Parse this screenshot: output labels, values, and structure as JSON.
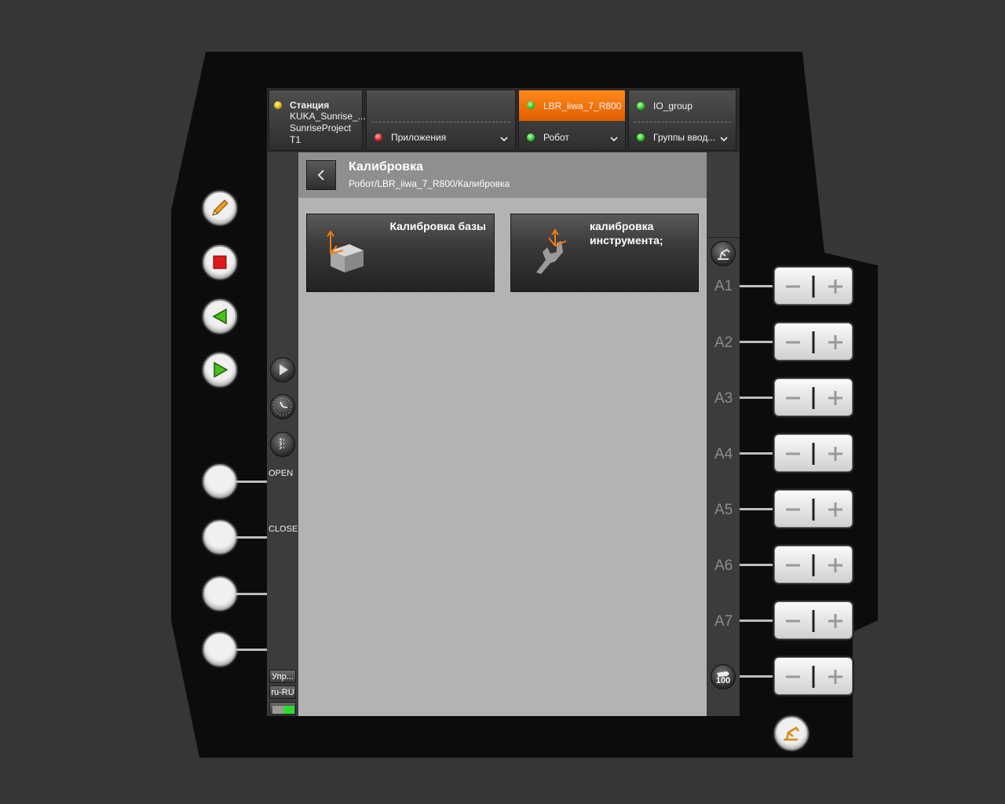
{
  "topbar": {
    "station": {
      "title": "Станция",
      "line1": "KUKA_Sunrise_...",
      "line2": "SunriseProject",
      "line3": "T1"
    },
    "applications": {
      "label": "Приложения"
    },
    "robot": {
      "name": "LBR_iiwa_7_R800",
      "label": "Робот"
    },
    "io": {
      "name": "IO_group",
      "label": "Группы ввод..."
    }
  },
  "side": {
    "open_label": "OPEN",
    "close_label": "CLOSE",
    "manage_label": "Упр...",
    "lang_label": "ru-RU"
  },
  "main": {
    "title": "Калибровка",
    "breadcrumb": "Робот/LBR_iiwa_7_R800/Калибровка",
    "cards": [
      {
        "label": "Калибровка базы"
      },
      {
        "label_line1": "калибровка",
        "label_line2": "инструмента;"
      }
    ]
  },
  "jog": {
    "axes": [
      "A1",
      "A2",
      "A3",
      "A4",
      "A5",
      "A6",
      "A7"
    ],
    "override": "100"
  },
  "colors": {
    "active_tab": "#f07a10",
    "main_bg": "#b3b3b3"
  }
}
